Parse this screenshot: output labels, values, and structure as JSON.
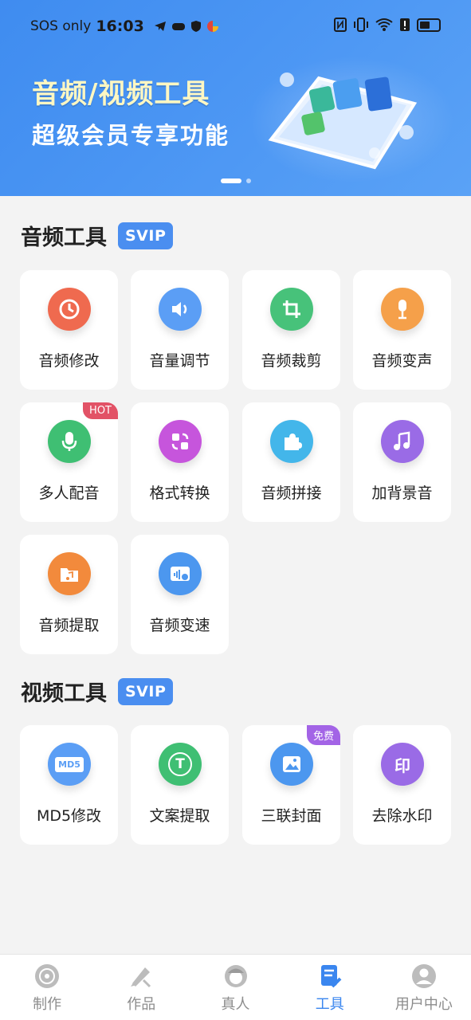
{
  "status_bar": {
    "carrier": "SOS only",
    "time": "16:03"
  },
  "banner": {
    "title": "音频/视频工具",
    "subtitle": "超级会员专享功能"
  },
  "audio_section": {
    "title": "音频工具",
    "badge": "SVIP",
    "items": [
      {
        "label": "音频修改",
        "icon": "audio-edit-icon",
        "color": "#ef6a4f"
      },
      {
        "label": "音量调节",
        "icon": "volume-icon",
        "color": "#5b9ef5"
      },
      {
        "label": "音频裁剪",
        "icon": "crop-icon",
        "color": "#47c27a"
      },
      {
        "label": "音频变声",
        "icon": "microphone-icon",
        "color": "#f5a04a"
      },
      {
        "label": "多人配音",
        "icon": "mic-icon",
        "color": "#3fbf73",
        "badge": "HOT"
      },
      {
        "label": "格式转换",
        "icon": "convert-icon",
        "color": "#c655dc"
      },
      {
        "label": "音频拼接",
        "icon": "puzzle-icon",
        "color": "#43b6ea"
      },
      {
        "label": "加背景音",
        "icon": "music-note-icon",
        "color": "#9a6be6"
      },
      {
        "label": "音频提取",
        "icon": "folder-music-icon",
        "color": "#f28a3c"
      },
      {
        "label": "音频变速",
        "icon": "speed-icon",
        "color": "#4c97ef"
      }
    ]
  },
  "video_section": {
    "title": "视频工具",
    "badge": "SVIP",
    "items": [
      {
        "label": "MD5修改",
        "icon": "md5-icon",
        "color": "#5b9ef5",
        "icon_text": "MD5"
      },
      {
        "label": "文案提取",
        "icon": "text-icon",
        "color": "#3fbf73",
        "icon_text": "T"
      },
      {
        "label": "三联封面",
        "icon": "image-icon",
        "color": "#4c97ef",
        "badge": "免费"
      },
      {
        "label": "去除水印",
        "icon": "stamp-icon",
        "color": "#9a6be6",
        "icon_text": "印"
      }
    ]
  },
  "tabbar": {
    "tabs": [
      {
        "label": "制作",
        "icon": "disc-icon"
      },
      {
        "label": "作品",
        "icon": "brush-icon"
      },
      {
        "label": "真人",
        "icon": "person-icon"
      },
      {
        "label": "工具",
        "icon": "tool-icon",
        "active": true
      },
      {
        "label": "用户中心",
        "icon": "user-icon"
      }
    ]
  },
  "colors": {
    "accent": "#3a86ef",
    "svip": "#4a8ef0",
    "hot": "#e25266",
    "free": "#a364e6"
  }
}
